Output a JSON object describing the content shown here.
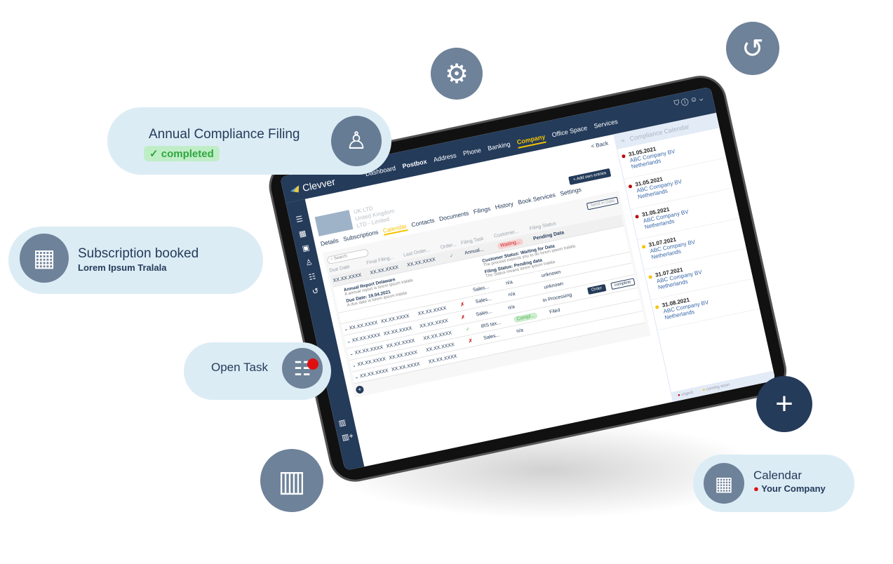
{
  "app": {
    "logo": "Clevver",
    "nav": [
      "Dashboard",
      "Postbox",
      "Address",
      "Phone",
      "Banking",
      "Company",
      "Office Space",
      "Services"
    ],
    "active_nav": "Company",
    "back": "< Back"
  },
  "company": {
    "name": "UK LTD",
    "country": "United Kingdom",
    "type": "LTD - Limited"
  },
  "tabs": [
    "Details",
    "Subscriptions",
    "Calendar",
    "Contacts",
    "Documents",
    "Filings",
    "History",
    "Book Services",
    "Settings"
  ],
  "active_tab": "Calendar",
  "add_entries": "+ Add own entries",
  "table": {
    "search_placeholder": "Search",
    "send_in_data": "Send in Data",
    "headers": [
      "Due Date",
      "Final Filing...",
      "Last Order...",
      "Order...",
      "Filing Task",
      "Customer...",
      "Filing Status"
    ],
    "expanded": {
      "due": "XX.XX.XXXX",
      "final": "XX.XX.XXXX",
      "last": "XX.XX.XXXX",
      "order": "✓",
      "task": "Annual...",
      "customer": "Waiting...",
      "status": "Pending Data",
      "detail_title": "Annual Report Delaware",
      "detail_desc": "A annual report is lorem ipsum tralala",
      "due_title": "Due Date: 19.04.2021",
      "due_desc": "A due date is lorem ipsum tralala",
      "cust_title": "Customer Status: Waiting for Data",
      "cust_desc": "The process expects you to do lorem ipsum tralala.",
      "filing_title": "Filing Status: Pending data",
      "filing_desc": "The Status means lorem ipsum tralala"
    },
    "rows": [
      {
        "due": "",
        "final": "",
        "last": "",
        "order": "",
        "task": "Sales...",
        "customer": "n/a",
        "status": "unknown"
      },
      {
        "due": "XX.XX.XXXX",
        "final": "XX.XX.XXXX",
        "last": "XX.XX.XXXX",
        "order": "✗",
        "task": "Sales...",
        "customer": "n/a",
        "status": "unknown"
      },
      {
        "due": "XX.XX.XXXX",
        "final": "XX.XX.XXXX",
        "last": "XX.XX.XXXX",
        "order": "✗",
        "task": "Sales...",
        "customer": "n/a",
        "status": "In Processing",
        "order_btn": "Order",
        "complete_btn": "complete"
      },
      {
        "due": "XX.XX.XXXX",
        "final": "XX.XX.XXXX",
        "last": "XX.XX.XXXX",
        "order": "✓",
        "task": "IRS tax...",
        "customer": "Compl...",
        "status": "Filed"
      },
      {
        "due": "XX.XX.XXXX",
        "final": "XX.XX.XXXX",
        "last": "XX.XX.XXXX",
        "order": "✗",
        "task": "Sales...",
        "customer": "n/a",
        "status": ""
      },
      {
        "due": "XX.XX.XXXX",
        "final": "XX.XX.XXXX",
        "last": "XX.XX.XXXX",
        "order": "",
        "task": "",
        "customer": "",
        "status": ""
      }
    ]
  },
  "calendar": {
    "title": "Compliance Calendar",
    "items": [
      {
        "date": "31.05.2021",
        "company": "ABC Company BV",
        "country": "Netherlands",
        "color": "#c00000"
      },
      {
        "date": "31.05.2021",
        "company": "ABC Company BV",
        "country": "Netherlands",
        "color": "#c00000"
      },
      {
        "date": "31.05.2021",
        "company": "ABC Company BV",
        "country": "Netherlands",
        "color": "#c00000"
      },
      {
        "date": "31.07.2021",
        "company": "ABC Company BV",
        "country": "Netherlands",
        "color": "#f6c400"
      },
      {
        "date": "31.07.2021",
        "company": "ABC Company BV",
        "country": "Netherlands",
        "color": "#f6c400"
      },
      {
        "date": "31.08.2021",
        "company": "ABC Company BV",
        "country": "Netherlands",
        "color": "#f6c400"
      }
    ],
    "legend": [
      "urgent",
      "coming soon"
    ]
  },
  "badges": {
    "annual": {
      "title": "Annual Compliance Filing",
      "status": "completed"
    },
    "subscription": {
      "title": "Subscription booked",
      "sub": "Lorem Ipsum Tralala"
    },
    "task": {
      "title": "Open Task"
    },
    "calendar": {
      "title": "Calendar",
      "sub": "Your Company"
    }
  },
  "colors": {
    "brand": "#243b5a",
    "accent": "#f6c400",
    "badge_bg": "#dcecf5",
    "icon_circle": "#6e8299"
  }
}
